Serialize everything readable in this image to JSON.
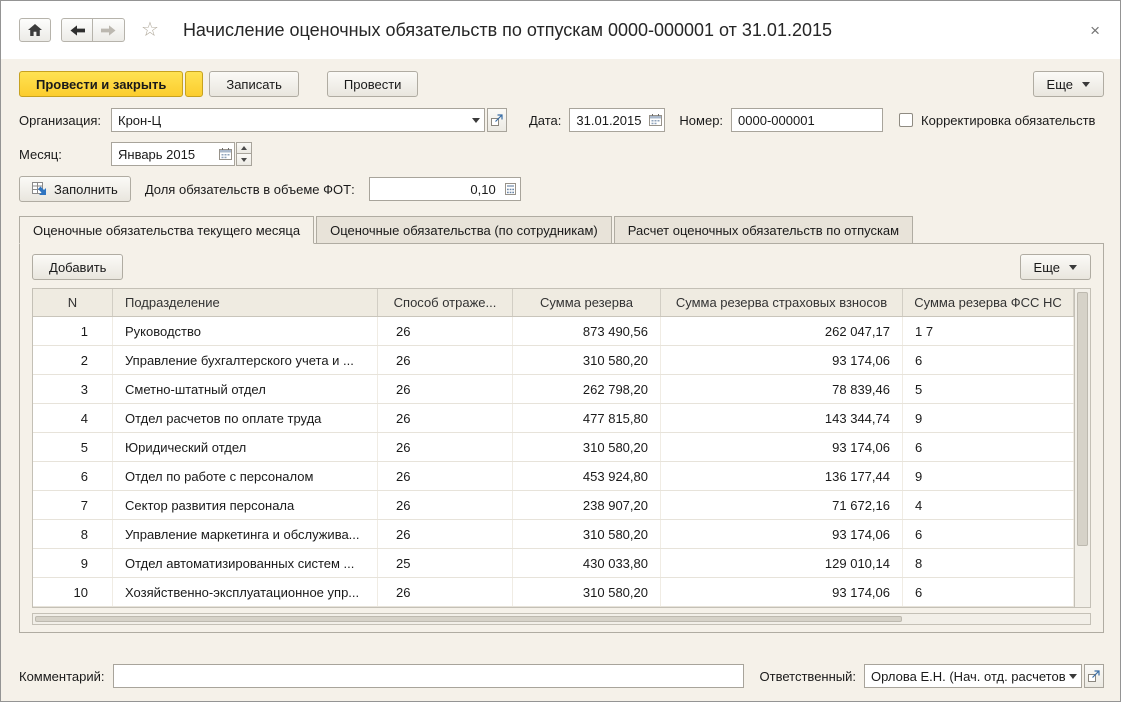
{
  "window": {
    "title": "Начисление оценочных обязательств по отпускам 0000-000001 от 31.01.2015",
    "close": "×"
  },
  "toolbar": {
    "post_and_close": "Провести и закрыть",
    "write": "Записать",
    "post": "Провести",
    "more": "Еще"
  },
  "form": {
    "org_label": "Организация:",
    "org_value": "Крон-Ц",
    "date_label": "Дата:",
    "date_value": "31.01.2015",
    "number_label": "Номер:",
    "number_value": "0000-000001",
    "correction_label": "Корректировка обязательств",
    "month_label": "Месяц:",
    "month_value": "Январь 2015",
    "fill_button": "Заполнить",
    "share_label": "Доля обязательств в объеме ФОТ:",
    "share_value": "0,10"
  },
  "tabs": [
    {
      "label": "Оценочные обязательства текущего месяца",
      "active": true
    },
    {
      "label": "Оценочные обязательства (по сотрудникам)",
      "active": false
    },
    {
      "label": "Расчет оценочных обязательств по отпускам",
      "active": false
    }
  ],
  "table_toolbar": {
    "add": "Добавить",
    "more": "Еще"
  },
  "table": {
    "headers": [
      "N",
      "Подразделение",
      "Способ отраже...",
      "Сумма резерва",
      "Сумма резерва страховых взносов",
      "Сумма резерва ФСС НС"
    ],
    "rows": [
      [
        "1",
        "Руководство",
        "26",
        "873 490,56",
        "262 047,17",
        "1 7"
      ],
      [
        "2",
        "Управление бухгалтерского учета и ...",
        "26",
        "310 580,20",
        "93 174,06",
        "6"
      ],
      [
        "3",
        "Сметно-штатный отдел",
        "26",
        "262 798,20",
        "78 839,46",
        "5"
      ],
      [
        "4",
        "Отдел расчетов по оплате труда",
        "26",
        "477 815,80",
        "143 344,74",
        "9"
      ],
      [
        "5",
        "Юридический отдел",
        "26",
        "310 580,20",
        "93 174,06",
        "6"
      ],
      [
        "6",
        "Отдел по работе с персоналом",
        "26",
        "453 924,80",
        "136 177,44",
        "9"
      ],
      [
        "7",
        "Сектор развития персонала",
        "26",
        "238 907,20",
        "71 672,16",
        "4"
      ],
      [
        "8",
        "Управление маркетинга и обслужива...",
        "26",
        "310 580,20",
        "93 174,06",
        "6"
      ],
      [
        "9",
        "Отдел автоматизированных систем ...",
        "25",
        "430 033,80",
        "129 010,14",
        "8"
      ],
      [
        "10",
        "Хозяйственно-эксплуатационное упр...",
        "26",
        "310 580,20",
        "93 174,06",
        "6"
      ]
    ]
  },
  "footer": {
    "comment_label": "Комментарий:",
    "responsible_label": "Ответственный:",
    "responsible_value": "Орлова Е.Н. (Нач. отд. расчетов"
  }
}
